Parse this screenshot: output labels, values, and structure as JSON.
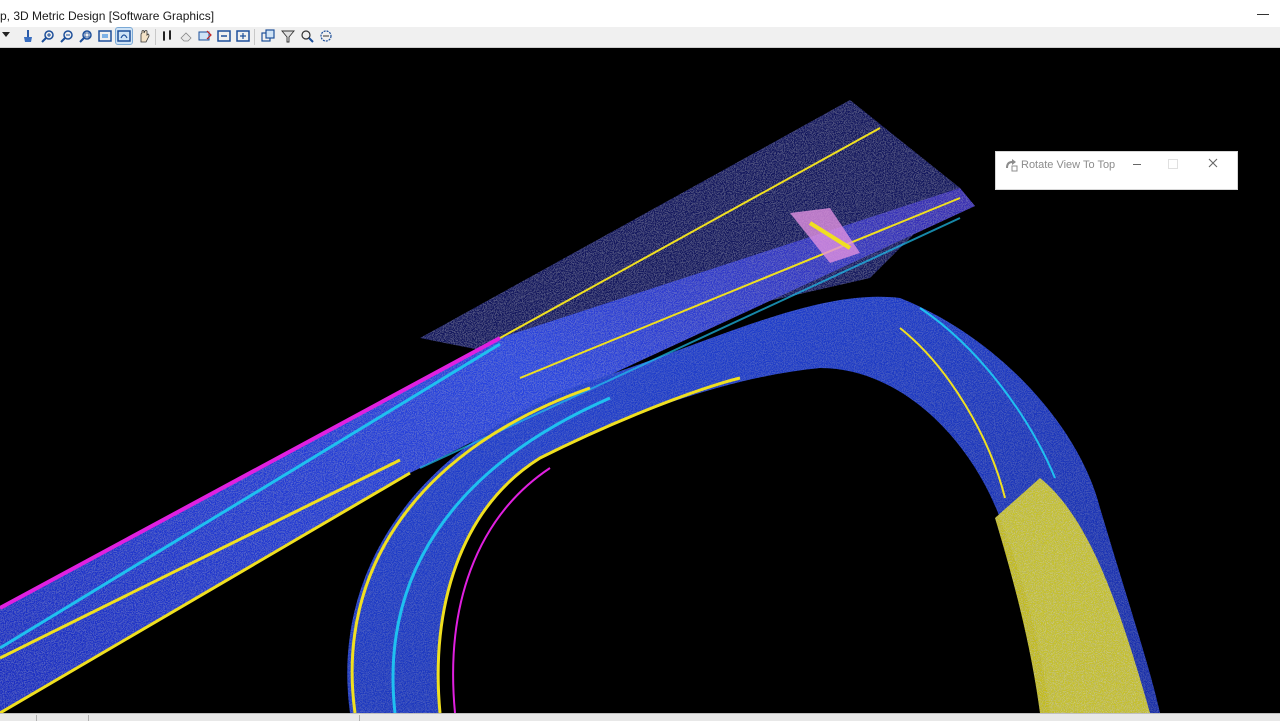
{
  "window": {
    "title": "p, 3D Metric Design [Software Graphics]"
  },
  "toolbar": {
    "buttons": [
      {
        "name": "clear-view-icon"
      },
      {
        "name": "zoom-in-icon"
      },
      {
        "name": "zoom-out-icon"
      },
      {
        "name": "window-area-icon"
      },
      {
        "name": "fit-view-icon"
      },
      {
        "name": "rotate-view-icon"
      },
      {
        "name": "pan-view-icon"
      },
      {
        "name": "walk-icon"
      },
      {
        "name": "view-previous-icon"
      },
      {
        "name": "view-next-icon"
      },
      {
        "name": "copy-view-icon"
      },
      {
        "name": "paste-view-icon"
      },
      {
        "name": "view-display-icon"
      },
      {
        "name": "view-filter-icon"
      },
      {
        "name": "view-attributes-icon"
      },
      {
        "name": "clip-volume-icon"
      }
    ]
  },
  "dialog": {
    "title": "Rotate View To Top"
  },
  "colors": {
    "cloud_blue": "#2a3fd6",
    "cloud_cyan": "#1fb4e6",
    "cloud_purple": "#7a2fd0",
    "cloud_magenta": "#e020e0",
    "cloud_yellow": "#f0e020",
    "background": "#000000"
  }
}
